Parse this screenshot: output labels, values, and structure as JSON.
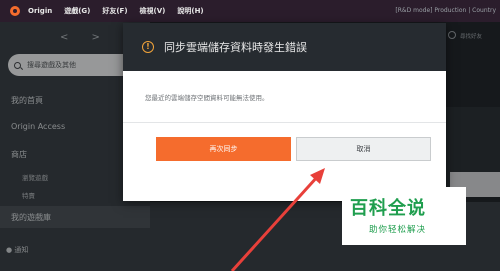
{
  "menubar": {
    "items": [
      "Origin",
      "遊戲(G)",
      "好友(F)",
      "檢視(V)",
      "說明(H)"
    ],
    "status": "[R&D mode] Production | Country"
  },
  "sidebar": {
    "nav_arrows": "< >",
    "search_placeholder": "搜尋遊戲及其他",
    "items": [
      {
        "label": "我的首頁"
      },
      {
        "label": "Origin Access"
      },
      {
        "label": "商店"
      }
    ],
    "store_sub": [
      "瀏覽遊戲",
      "特賣"
    ],
    "active_label": "我的遊戲庫",
    "notify_label": "通知"
  },
  "main": {
    "friends_label": "尋找好友"
  },
  "dialog": {
    "title": "同步雲端儲存資料時發生錯誤",
    "message": "您最近的雲端儲存空間資料可能無法使用。",
    "retry_label": "再次同步",
    "cancel_label": "取消",
    "warning_glyph": "!",
    "warning_color": "#f1a33a",
    "accent_color": "#f56c2d"
  },
  "watermark": {
    "title": "百科全说",
    "subtitle": "助你轻松解决"
  }
}
